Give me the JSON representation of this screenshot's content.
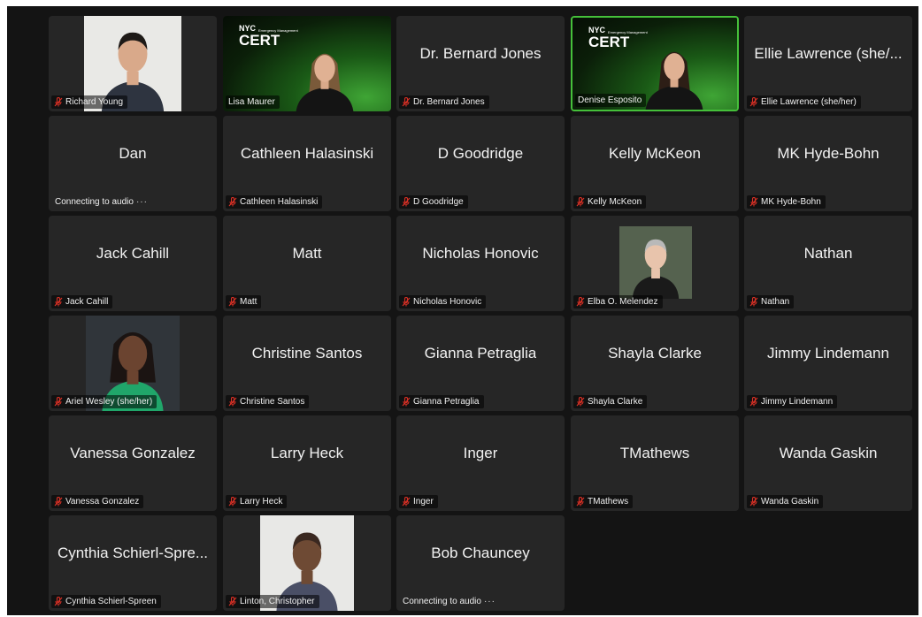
{
  "colors": {
    "frame": "#141414",
    "tile": "#262626",
    "active_border": "#45c03a",
    "mute": "#d93025"
  },
  "cert_logo": {
    "nyc": "NYC",
    "sub": "Emergency Management",
    "cert": "CERT"
  },
  "tiles": [
    {
      "name": "Richard Young",
      "label": "Richard Young",
      "muted": true,
      "video": "photo-man"
    },
    {
      "name": "Lisa Maurer",
      "label": "Lisa Maurer",
      "muted": false,
      "video": "cert-woman"
    },
    {
      "name": "Dr. Bernard Jones",
      "label": "Dr. Bernard Jones",
      "muted": true
    },
    {
      "name": "Denise Esposito",
      "label": "Denise Esposito",
      "muted": false,
      "video": "cert-woman2",
      "active": true
    },
    {
      "name": "Ellie Lawrence (she/...",
      "label": "Ellie Lawrence (she/her)",
      "muted": true
    },
    {
      "name": "Dan",
      "label": "Connecting to audio",
      "connecting": true
    },
    {
      "name": "Cathleen Halasinski",
      "label": "Cathleen Halasinski",
      "muted": true
    },
    {
      "name": "D Goodridge",
      "label": "D Goodridge",
      "muted": true
    },
    {
      "name": "Kelly McKeon",
      "label": "Kelly McKeon",
      "muted": true
    },
    {
      "name": "MK Hyde-Bohn",
      "label": "MK Hyde-Bohn",
      "muted": true
    },
    {
      "name": "Jack Cahill",
      "label": "Jack Cahill",
      "muted": true
    },
    {
      "name": "Matt",
      "label": "Matt",
      "muted": true
    },
    {
      "name": "Nicholas Honovic",
      "label": "Nicholas Honovic",
      "muted": true
    },
    {
      "name": "Elba O. Melendez",
      "label": "Elba O. Melendez",
      "muted": true,
      "video": "photo-elba"
    },
    {
      "name": "Nathan",
      "label": "Nathan",
      "muted": true
    },
    {
      "name": "Ariel Wesley (she/her)",
      "label": "Ariel Wesley (she/her)",
      "muted": true,
      "video": "photo-ariel"
    },
    {
      "name": "Christine Santos",
      "label": "Christine Santos",
      "muted": true
    },
    {
      "name": "Gianna Petraglia",
      "label": "Gianna Petraglia",
      "muted": true
    },
    {
      "name": "Shayla Clarke",
      "label": "Shayla Clarke",
      "muted": true
    },
    {
      "name": "Jimmy Lindemann",
      "label": "Jimmy Lindemann",
      "muted": true
    },
    {
      "name": "Vanessa Gonzalez",
      "label": "Vanessa Gonzalez",
      "muted": true
    },
    {
      "name": "Larry Heck",
      "label": "Larry Heck",
      "muted": true
    },
    {
      "name": "Inger",
      "label": "Inger",
      "muted": true
    },
    {
      "name": "TMathews",
      "label": "TMathews",
      "muted": true
    },
    {
      "name": "Wanda Gaskin",
      "label": "Wanda Gaskin",
      "muted": true
    },
    {
      "name": "Cynthia Schierl-Spre...",
      "label": "Cynthia Schierl-Spreen",
      "muted": true
    },
    {
      "name": "Linton, Christopher",
      "label": "Linton, Christopher",
      "muted": true,
      "video": "photo-linton"
    },
    {
      "name": "Bob Chauncey",
      "label": "Connecting to audio",
      "connecting": true
    }
  ]
}
